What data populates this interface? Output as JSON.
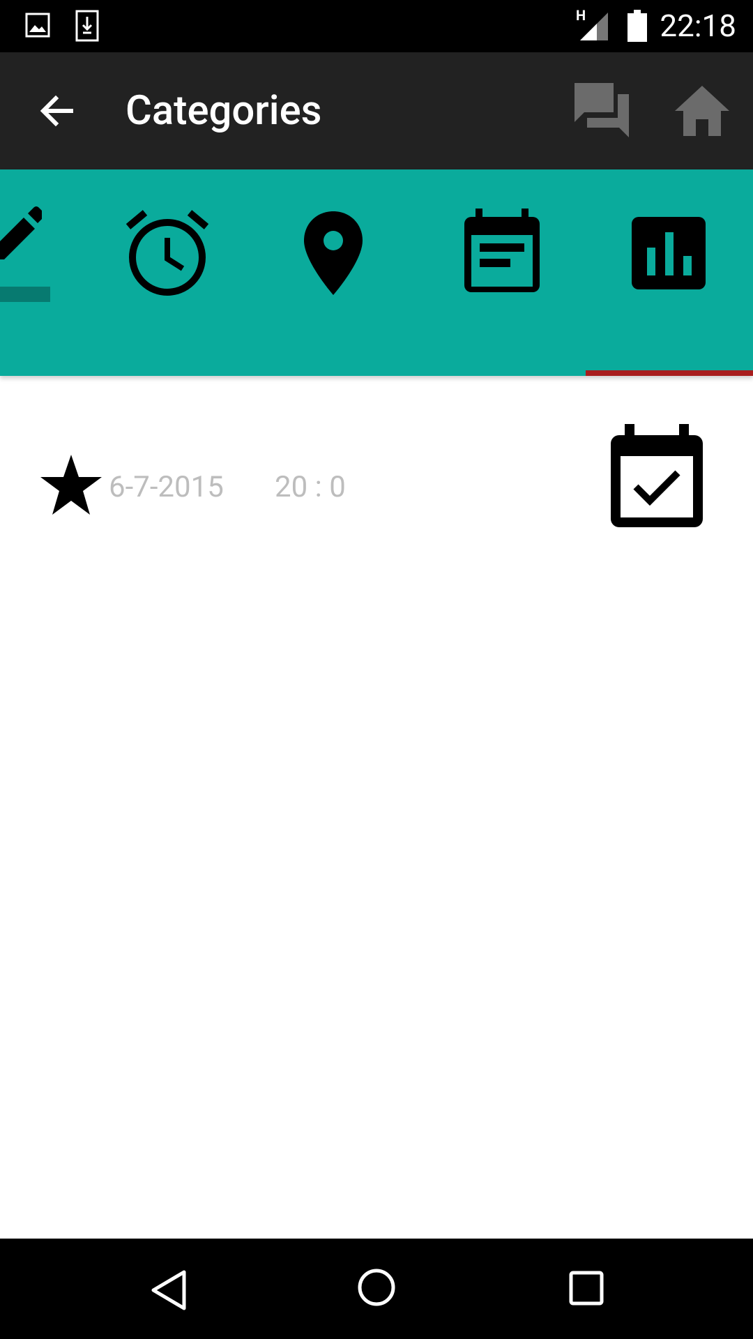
{
  "status_bar": {
    "time": "22:18",
    "network_label": "H",
    "icons": [
      "image-icon",
      "download-icon",
      "signal-icon",
      "battery-icon"
    ]
  },
  "toolbar": {
    "title": "Categories",
    "back_icon": "arrow-back-icon",
    "actions": [
      "forum-icon",
      "home-icon"
    ]
  },
  "tabs": {
    "items": [
      "edit-icon",
      "alarm-icon",
      "location-icon",
      "event-note-icon",
      "chart-icon"
    ],
    "selected": "chart-icon",
    "background": "#0aab9c",
    "indicator_color": "#a81d1d"
  },
  "item": {
    "favorite_icon": "star-icon",
    "date": "6-7-2015",
    "time": "20 : 0",
    "action_icon": "event-available-icon"
  },
  "nav": [
    "back-nav-icon",
    "home-nav-icon",
    "recents-nav-icon"
  ]
}
